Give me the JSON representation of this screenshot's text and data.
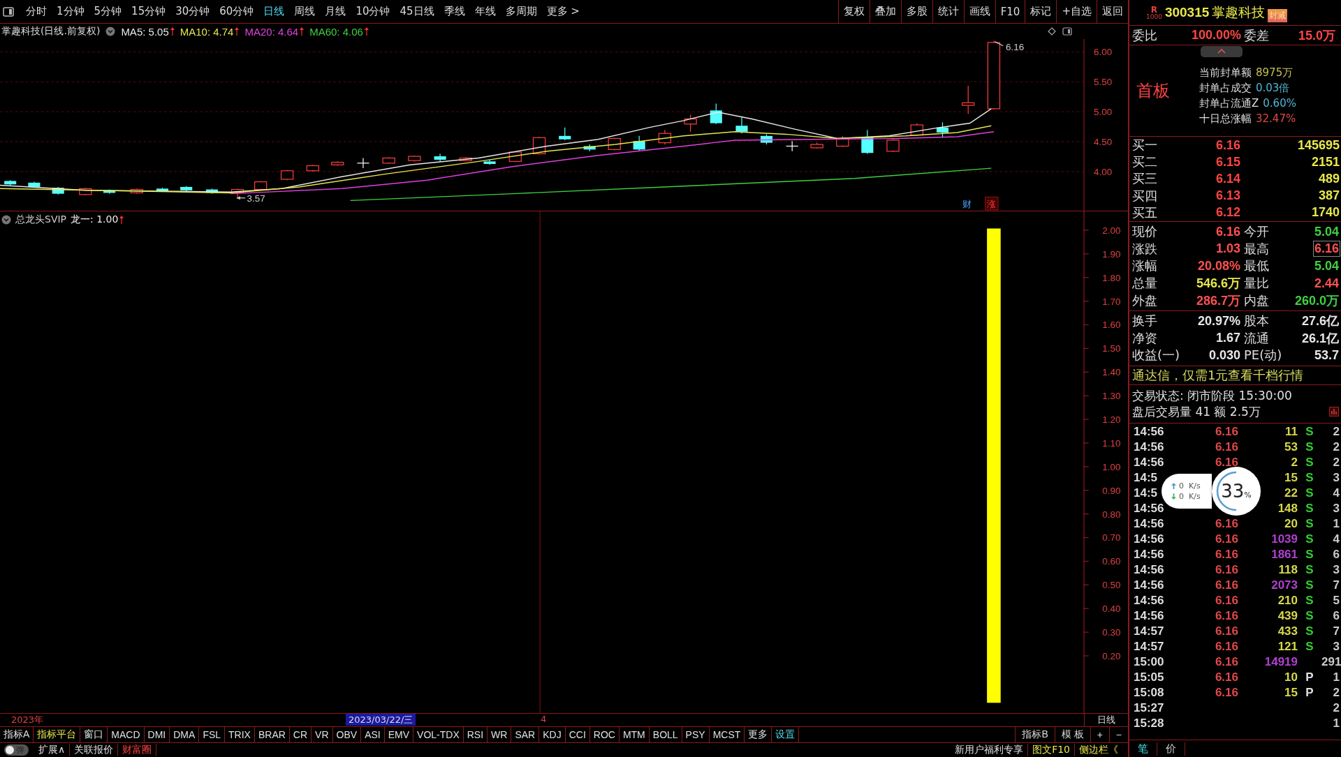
{
  "toolbar": {
    "periods": [
      {
        "label": "分时",
        "selected": false
      },
      {
        "label": "1分钟",
        "selected": false
      },
      {
        "label": "5分钟",
        "selected": false
      },
      {
        "label": "15分钟",
        "selected": false
      },
      {
        "label": "30分钟",
        "selected": false
      },
      {
        "label": "60分钟",
        "selected": false
      },
      {
        "label": "日线",
        "selected": true
      },
      {
        "label": "周线",
        "selected": false
      },
      {
        "label": "月线",
        "selected": false
      },
      {
        "label": "10分钟",
        "selected": false
      },
      {
        "label": "45日线",
        "selected": false
      },
      {
        "label": "季线",
        "selected": false
      },
      {
        "label": "年线",
        "selected": false
      },
      {
        "label": "多周期",
        "selected": false
      },
      {
        "label": "更多 >",
        "selected": false
      }
    ],
    "actions": [
      "复权",
      "叠加",
      "多股",
      "统计",
      "画线",
      "F10",
      "标记",
      "+自选",
      "返回"
    ]
  },
  "price_chart": {
    "title": "掌趣科技(日线.前复权)",
    "ma": [
      {
        "label": "MA5: 5.05",
        "color": "#e8e8e8"
      },
      {
        "label": "MA10: 4.74",
        "color": "#e6e64c"
      },
      {
        "label": "MA20: 4.64",
        "color": "#e040e0"
      },
      {
        "label": "MA60: 4.06",
        "color": "#40d040"
      }
    ],
    "axis": [
      "6.00",
      "5.50",
      "5.00",
      "4.50",
      "4.00"
    ],
    "low_label": "3.57",
    "high_label": "6.16",
    "tags": [
      "财",
      "涨"
    ]
  },
  "indicator": {
    "title": "总龙头SVIP",
    "value": "龙一: 1.00",
    "axis": [
      "2.00",
      "1.90",
      "1.80",
      "1.70",
      "1.60",
      "1.50",
      "1.40",
      "1.30",
      "1.20",
      "1.10",
      "1.00",
      "0.90",
      "0.80",
      "0.70",
      "0.60",
      "0.50",
      "0.40",
      "0.30",
      "0.20"
    ]
  },
  "date_bar": {
    "year": "2023年",
    "cursor": "2023/03/22/三",
    "marker": "4",
    "period": "日线"
  },
  "indicator_tabs": [
    {
      "label": "指标A",
      "color": "#e0e0e0"
    },
    {
      "label": "指标平台",
      "color": "#e6e64c"
    },
    {
      "label": "窗口",
      "color": "#e0e0e0"
    },
    {
      "label": "MACD",
      "color": "#e0e0e0"
    },
    {
      "label": "DMI",
      "color": "#e0e0e0"
    },
    {
      "label": "DMA",
      "color": "#e0e0e0"
    },
    {
      "label": "FSL",
      "color": "#e0e0e0"
    },
    {
      "label": "TRIX",
      "color": "#e0e0e0"
    },
    {
      "label": "BRAR",
      "color": "#e0e0e0"
    },
    {
      "label": "CR",
      "color": "#e0e0e0"
    },
    {
      "label": "VR",
      "color": "#e0e0e0"
    },
    {
      "label": "OBV",
      "color": "#e0e0e0"
    },
    {
      "label": "ASI",
      "color": "#e0e0e0"
    },
    {
      "label": "EMV",
      "color": "#e0e0e0"
    },
    {
      "label": "VOL-TDX",
      "color": "#e0e0e0"
    },
    {
      "label": "RSI",
      "color": "#e0e0e0"
    },
    {
      "label": "WR",
      "color": "#e0e0e0"
    },
    {
      "label": "SAR",
      "color": "#e0e0e0"
    },
    {
      "label": "KDJ",
      "color": "#e0e0e0"
    },
    {
      "label": "CCI",
      "color": "#e0e0e0"
    },
    {
      "label": "ROC",
      "color": "#e0e0e0"
    },
    {
      "label": "MTM",
      "color": "#e0e0e0"
    },
    {
      "label": "BOLL",
      "color": "#e0e0e0"
    },
    {
      "label": "PSY",
      "color": "#e0e0e0"
    },
    {
      "label": "MCST",
      "color": "#e0e0e0"
    },
    {
      "label": "更多",
      "color": "#e0e0e0"
    },
    {
      "label": "设置",
      "color": "#4fd8e8"
    }
  ],
  "right_tabs": [
    "指标B",
    "模 板",
    "+",
    "−"
  ],
  "status_bar": {
    "toggle": {
      "label": "弹",
      "on": false
    },
    "left": [
      {
        "label": "扩展∧",
        "color": "#e0e0e0"
      },
      {
        "label": "关联报价",
        "color": "#e0e0e0"
      },
      {
        "label": "财富圈",
        "color": "#ff4040"
      }
    ],
    "right": [
      {
        "label": "新用户福利专享",
        "color": "#e0e0e0"
      },
      {
        "label": "图文F10",
        "color": "#e6e64c"
      },
      {
        "label": "侧边栏《",
        "color": "#e6e64c"
      }
    ]
  },
  "quote": {
    "market": "R",
    "market_sub": "1000",
    "code": "300315",
    "name": "掌趣科技",
    "badge": "封减",
    "ratio": [
      {
        "label": "委比",
        "value": "100.00%"
      },
      {
        "label": "委差",
        "value": "15.0万"
      }
    ],
    "limit": {
      "title": "首板",
      "lines": [
        {
          "label": "当前封单额",
          "value": "8975万",
          "color": "#c8c050"
        },
        {
          "label": "封单占成交",
          "value": "0.03倍",
          "color": "#4fb8d8"
        },
        {
          "label": "封单占流通Z",
          "value": "0.60%",
          "color": "#4fb8d8"
        },
        {
          "label": "十日总涨幅",
          "value": "32.47%",
          "color": "#e04848"
        }
      ]
    },
    "bids": [
      {
        "label": "买一",
        "price": "6.16",
        "volume": "145695"
      },
      {
        "label": "买二",
        "price": "6.15",
        "volume": "2151"
      },
      {
        "label": "买三",
        "price": "6.14",
        "volume": "489"
      },
      {
        "label": "买四",
        "price": "6.13",
        "volume": "387"
      },
      {
        "label": "买五",
        "price": "6.12",
        "volume": "1740"
      }
    ],
    "stats": [
      {
        "label": "现价",
        "value": "6.16",
        "color": "#ff5050",
        "boxed": false
      },
      {
        "label": "今开",
        "value": "5.04",
        "color": "#40d040",
        "boxed": false
      },
      {
        "label": "涨跌",
        "value": "1.03",
        "color": "#ff5050",
        "boxed": false
      },
      {
        "label": "最高",
        "value": "6.16",
        "color": "#ff5050",
        "boxed": true
      },
      {
        "label": "涨幅",
        "value": "20.08%",
        "color": "#ff5050",
        "boxed": false
      },
      {
        "label": "最低",
        "value": "5.04",
        "color": "#40d040",
        "boxed": false
      },
      {
        "label": "总量",
        "value": "546.6万",
        "color": "#e6e64c",
        "boxed": false
      },
      {
        "label": "量比",
        "value": "2.44",
        "color": "#ff5050",
        "boxed": false
      },
      {
        "label": "外盘",
        "value": "286.7万",
        "color": "#ff5050",
        "boxed": false
      },
      {
        "label": "内盘",
        "value": "260.0万",
        "color": "#40d040",
        "boxed": false
      }
    ],
    "stats2": [
      {
        "label": "换手",
        "value": "20.97%"
      },
      {
        "label": "股本",
        "value": "27.6亿"
      },
      {
        "label": "净资",
        "value": "1.67"
      },
      {
        "label": "流通",
        "value": "26.1亿"
      },
      {
        "label": "收益(一)",
        "value": "0.030"
      },
      {
        "label": "PE(动)",
        "value": "53.7"
      }
    ],
    "ad": "通达信，仅需1元查看千档行情",
    "status": "交易状态: 闭市阶段 15:30:00",
    "after_hours": "盘后交易量 41 额 2.5万",
    "ticks": [
      {
        "time": "14:56",
        "price": "6.16",
        "volume": "11",
        "big": false,
        "side": "S",
        "count": "2"
      },
      {
        "time": "14:56",
        "price": "6.16",
        "volume": "53",
        "big": false,
        "side": "S",
        "count": "2"
      },
      {
        "time": "14:56",
        "price": "6.16",
        "volume": "2",
        "big": false,
        "side": "S",
        "count": "2"
      },
      {
        "time": "14:5",
        "volume": "15",
        "big": false,
        "side": "S",
        "count": "3"
      },
      {
        "time": "14:5",
        "volume": "22",
        "big": false,
        "side": "S",
        "count": "4"
      },
      {
        "time": "14:56",
        "volume": "148",
        "big": false,
        "side": "S",
        "count": "3"
      },
      {
        "time": "14:56",
        "price": "6.16",
        "volume": "20",
        "big": false,
        "side": "S",
        "count": "1"
      },
      {
        "time": "14:56",
        "price": "6.16",
        "volume": "1039",
        "big": true,
        "side": "S",
        "count": "4"
      },
      {
        "time": "14:56",
        "price": "6.16",
        "volume": "1861",
        "big": true,
        "side": "S",
        "count": "6"
      },
      {
        "time": "14:56",
        "price": "6.16",
        "volume": "118",
        "big": false,
        "side": "S",
        "count": "3"
      },
      {
        "time": "14:56",
        "price": "6.16",
        "volume": "2073",
        "big": true,
        "side": "S",
        "count": "7"
      },
      {
        "time": "14:56",
        "price": "6.16",
        "volume": "210",
        "big": false,
        "side": "S",
        "count": "5"
      },
      {
        "time": "14:56",
        "price": "6.16",
        "volume": "439",
        "big": false,
        "side": "S",
        "count": "6"
      },
      {
        "time": "14:57",
        "price": "6.16",
        "volume": "433",
        "big": false,
        "side": "S",
        "count": "7"
      },
      {
        "time": "14:57",
        "price": "6.16",
        "volume": "121",
        "big": false,
        "side": "S",
        "count": "3"
      },
      {
        "time": "15:00",
        "price": "6.16",
        "volume": "14919",
        "big": true,
        "count": "291"
      },
      {
        "time": "15:05",
        "price": "6.16",
        "volume": "10",
        "big": false,
        "side": "P",
        "count": "1"
      },
      {
        "time": "15:08",
        "price": "6.16",
        "volume": "15",
        "big": false,
        "side": "P",
        "count": "2"
      },
      {
        "time": "15:27",
        "count": "2"
      },
      {
        "time": "15:28",
        "count": "1"
      }
    ],
    "tabs": [
      {
        "label": "笔",
        "selected": true
      },
      {
        "label": "价",
        "selected": false
      }
    ]
  },
  "speed_widget": {
    "up": "0  K/s",
    "down": "0  K/s",
    "percent": "33",
    "unit": "%"
  }
}
